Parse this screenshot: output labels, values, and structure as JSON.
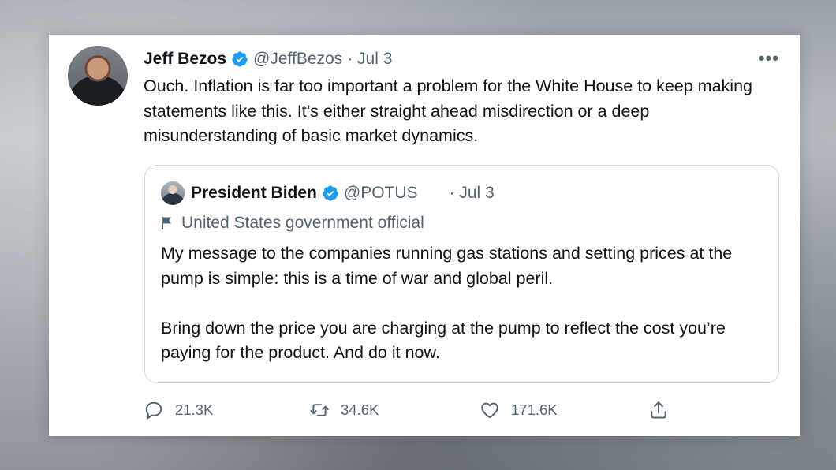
{
  "tweet": {
    "author_name": "Jeff Bezos",
    "author_handle": "@JeffBezos",
    "date": "· Jul 3",
    "more_label": "•••",
    "text": "Ouch. Inflation is far too important a problem for the White House to keep making statements like this. It’s either straight ahead misdirection or a deep misunderstanding of basic market dynamics.",
    "icons": {
      "verified": "verified-badge-icon",
      "more": "more-options-icon"
    }
  },
  "quote": {
    "author_name": "President Biden",
    "author_handle": "@POTUS",
    "date": "· Jul 3",
    "label": "United States government official",
    "paragraphs": [
      "My message to the companies running gas stations and setting prices at the pump is simple: this is a time of war and global peril.",
      "Bring down the price you are charging at the pump to reflect the cost you’re paying for the product. And do it now."
    ],
    "icons": {
      "label": "flag-icon"
    }
  },
  "actions": {
    "reply_count": "21.3K",
    "retweet_count": "34.6K",
    "like_count": "171.6K",
    "icons": [
      "reply-icon",
      "retweet-icon",
      "like-icon",
      "share-icon"
    ]
  },
  "colors": {
    "verified_blue": "#1d9bf0",
    "text_primary": "#0f1419",
    "text_secondary": "#536471",
    "border": "#cfd9de"
  }
}
